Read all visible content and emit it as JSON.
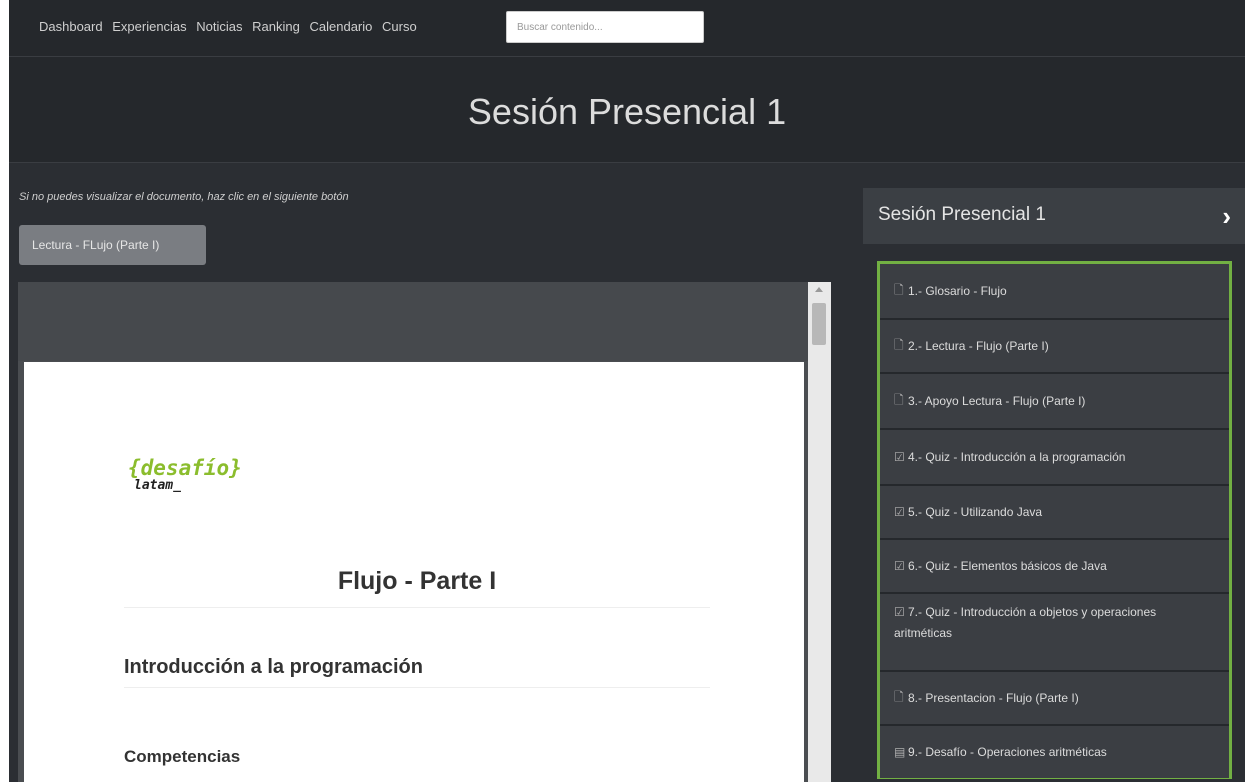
{
  "nav": {
    "links": [
      "Dashboard",
      "Experiencias",
      "Noticias",
      "Ranking",
      "Calendario",
      "Curso"
    ],
    "search_placeholder": "Buscar contenido..."
  },
  "hero": {
    "title": "Sesión Presencial 1"
  },
  "main": {
    "hint": "Si no puedes visualizar el documento, haz clic en el siguiente botón",
    "document_button": "Lectura - FLujo (Parte I)"
  },
  "document": {
    "logo_main": "{desafío}",
    "logo_sub": "latam_",
    "title": "Flujo - Parte I",
    "section": "Introducción a la programación",
    "subsection": "Competencias"
  },
  "sidebar": {
    "title": "Sesión Presencial 1",
    "accent_color": "#72b043",
    "items": [
      {
        "label": "1.- Glosario - Flujo",
        "icon": "pdf-icon"
      },
      {
        "label": "2.- Lectura - Flujo (Parte I)",
        "icon": "pdf-icon"
      },
      {
        "label": "3.- Apoyo Lectura - Flujo (Parte I)",
        "icon": "pdf-icon"
      },
      {
        "label": "4.- Quiz - Introducción a la programación",
        "icon": "quiz-check-icon"
      },
      {
        "label": "5.- Quiz - Utilizando Java",
        "icon": "quiz-check-icon"
      },
      {
        "label": "6.- Quiz - Elementos básicos de Java",
        "icon": "quiz-check-icon"
      },
      {
        "label": "7.- Quiz - Introducción a objetos y operaciones aritméticas",
        "icon": "quiz-check-icon"
      },
      {
        "label": "8.- Presentacion - Flujo (Parte I)",
        "icon": "pdf-icon"
      },
      {
        "label": "9.- Desafío - Operaciones aritméticas",
        "icon": "document-icon"
      }
    ]
  }
}
